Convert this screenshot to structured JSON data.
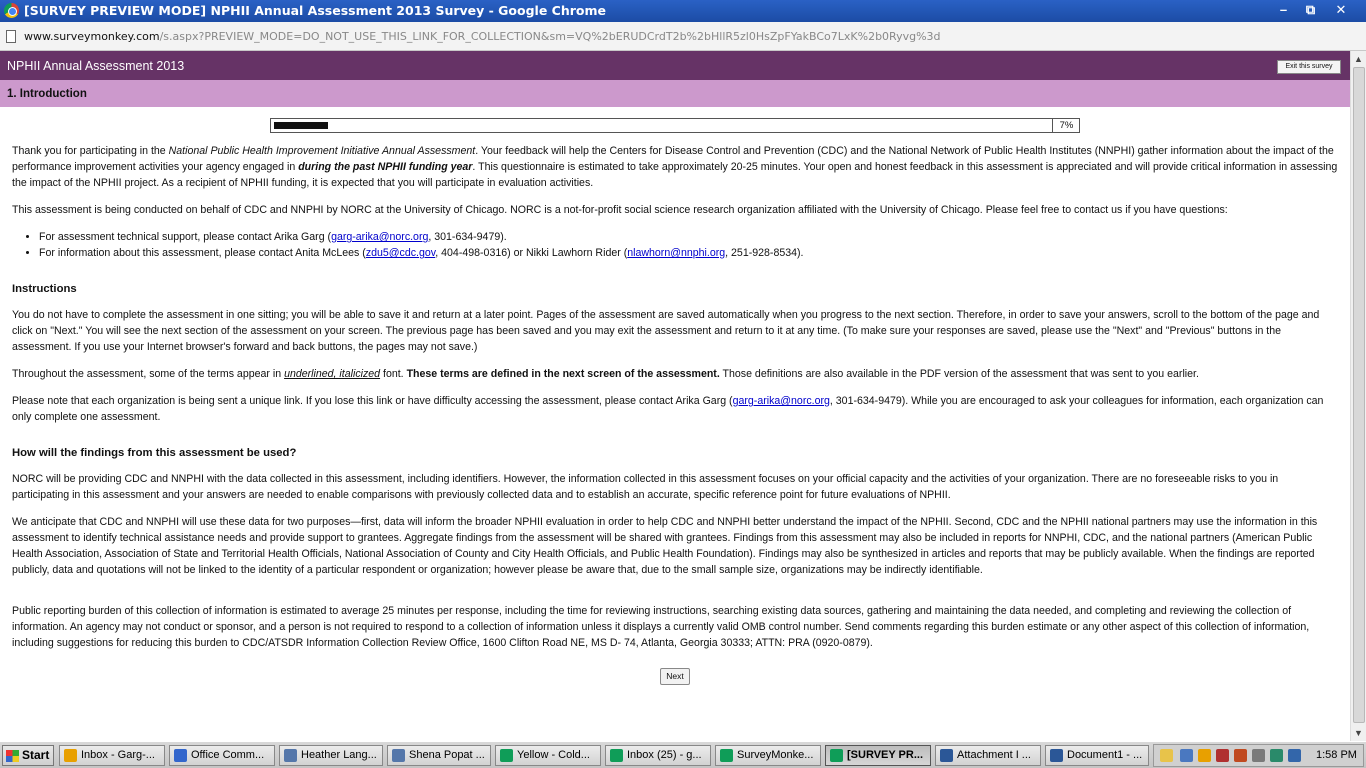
{
  "window": {
    "title": "[SURVEY PREVIEW MODE] NPHII Annual Assessment 2013 Survey - Google Chrome",
    "min": "–",
    "max": "⧉",
    "close": "✕"
  },
  "address": {
    "host": "www.surveymonkey.com",
    "path": "/s.aspx?PREVIEW_MODE=DO_NOT_USE_THIS_LINK_FOR_COLLECTION&sm=VQ%2bERUDCrdT2b%2bHllR5zl0HsZpFYakBCo7LxK%2b0Ryvg%3d"
  },
  "survey": {
    "title": "NPHII Annual Assessment 2013",
    "exit_label": "Exit this survey",
    "page_title": "1. Introduction",
    "progress_pct": 7,
    "progress_label": "7%",
    "next_label": "Next"
  },
  "content": {
    "p1_a": "Thank you for participating in the ",
    "p1_italic": "National Public Health Improvement Initiative Annual Assessment",
    "p1_b": ". Your feedback will help the Centers for Disease Control and Prevention (CDC) and the National Network of Public Health Institutes (NNPHI) gather information about the impact of the performance improvement activities your agency engaged in ",
    "p1_bolditalic": "during the past NPHII funding year",
    "p1_c": ". This questionnaire is estimated to take approximately 20-25 minutes. Your open and honest feedback in this assessment is appreciated and will provide critical information in assessing the impact of the NPHII project. As a recipient of NPHII funding, it is expected that you will participate in evaluation activities.",
    "p2": "This assessment is being conducted on behalf of CDC and NNPHI by NORC at the University of Chicago. NORC is a not-for-profit social science research organization affiliated with the University of Chicago. Please feel free to contact us if you have questions:",
    "li1_a": "For assessment technical support, please contact Arika Garg (",
    "li1_link": "garg-arika@norc.org",
    "li1_b": ", 301-634-9479).",
    "li2_a": "For information about this assessment, please contact Anita McLees (",
    "li2_link1": "zdu5@cdc.gov",
    "li2_b": ", 404-498-0316) or Nikki Lawhorn Rider (",
    "li2_link2": "nlawhorn@nnphi.org",
    "li2_c": ", 251-928-8534).",
    "h_instructions": "Instructions",
    "p3": "You do not have to complete the assessment in one sitting; you will be able to save it and return at a later point. Pages of the assessment are saved automatically when you progress to the next section. Therefore, in order to save your answers, scroll to the bottom of the page and click on \"Next.\" You will see the next section of the assessment on your screen. The previous page has been saved and you may exit the assessment and return to it at any time. (To make sure your responses are saved, please use the \"Next\" and \"Previous\" buttons in the assessment. If you use your Internet browser's forward and back buttons, the pages may not save.)",
    "p4_a": "Throughout the assessment, some of the terms appear in ",
    "p4_ui": "underlined, italicized",
    "p4_b": " font. ",
    "p4_bold": "These terms are defined in the next screen of the assessment.",
    "p4_c": " Those definitions are also available in the PDF version of the assessment that was sent to you earlier.",
    "p5_a": "Please note that each organization is being sent a unique link. If you lose this link or have difficulty accessing the assessment, please contact Arika Garg (",
    "p5_link": "garg-arika@norc.org",
    "p5_b": ", 301-634-9479). While you are encouraged to ask your colleagues for information, each organization can only complete one assessment.",
    "h_findings": "How will the findings from this assessment be used?",
    "p6": "NORC will be providing CDC and NNPHI with the data collected in this assessment, including identifiers. However, the information collected in this assessment focuses on your official capacity and the activities of your organization. There are no foreseeable risks to you in participating in this assessment and your answers are needed to enable comparisons with previously collected data and to establish an accurate, specific reference point for future evaluations of NPHII.",
    "p7": "We anticipate that CDC and NNPHI will use these data for two purposes—first, data will inform the broader NPHII evaluation in order to help CDC and NNPHI better understand the impact of the NPHII. Second, CDC and the NPHII national partners may use the information in this assessment to identify technical assistance needs and provide support to grantees. Aggregate findings from the assessment will be shared with grantees. Findings from this assessment may also be included in reports for NNPHI, CDC, and the national partners (American Public Health Association, Association of State and Territorial Health Officials, National Association of County and City Health Officials, and Public Health Foundation). Findings may also be synthesized in articles and reports that may be publicly available. When the findings are reported publicly, data and quotations will not be linked to the identity of a particular respondent or organization; however please be aware that, due to the small sample size, organizations may be indirectly identifiable.",
    "p8": "Public reporting burden of this collection of information is estimated to average 25 minutes per response, including the time for reviewing instructions, searching existing data sources, gathering and maintaining the data needed, and completing and reviewing the collection of information. An agency may not conduct or sponsor, and a person is not required to respond to a collection of information unless it displays a currently valid OMB control number. Send comments regarding this burden estimate or any other aspect of this collection of information, including suggestions for reducing this burden to CDC/ATSDR Information Collection Review Office, 1600 Clifton Road NE, MS D- 74, Atlanta, Georgia 30333; ATTN: PRA (0920-0879)."
  },
  "taskbar": {
    "start": "Start",
    "tasks": [
      {
        "label": "Inbox - Garg-...",
        "icon": "outlook-icon",
        "color": "#e8a000"
      },
      {
        "label": "Office Comm...",
        "icon": "office-communicator-icon",
        "color": "#3366cc"
      },
      {
        "label": "Heather Lang...",
        "icon": "chat-icon",
        "color": "#5577aa"
      },
      {
        "label": "Shena Popat ...",
        "icon": "chat-icon",
        "color": "#5577aa"
      },
      {
        "label": "Yellow - Cold...",
        "icon": "chrome-icon",
        "color": "#0f9d58"
      },
      {
        "label": "Inbox (25) - g...",
        "icon": "chrome-icon",
        "color": "#0f9d58"
      },
      {
        "label": "SurveyMonke...",
        "icon": "chrome-icon",
        "color": "#0f9d58"
      },
      {
        "label": "[SURVEY PR...",
        "icon": "chrome-icon",
        "color": "#0f9d58"
      },
      {
        "label": "Attachment I ...",
        "icon": "word-icon",
        "color": "#2b5797"
      },
      {
        "label": "Document1 - ...",
        "icon": "word-icon",
        "color": "#2b5797"
      }
    ],
    "clock": "1:58 PM"
  }
}
